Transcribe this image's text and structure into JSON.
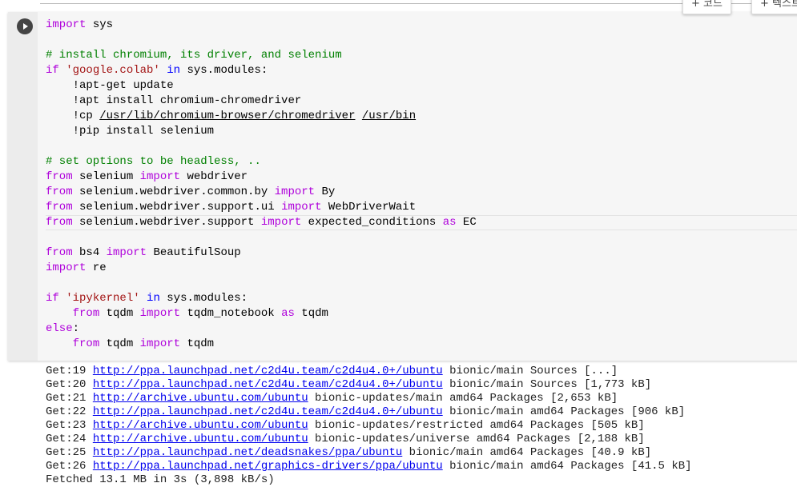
{
  "toolbar": {
    "add_code": "+ 코드",
    "add_text": "+ 텍스트"
  },
  "code_lines": [
    [
      [
        "kw",
        "import"
      ],
      [
        "t",
        " sys"
      ]
    ],
    [],
    [
      [
        "cm",
        "# install chromium, its driver, and selenium"
      ]
    ],
    [
      [
        "kw",
        "if"
      ],
      [
        "t",
        " "
      ],
      [
        "str",
        "'google.colab'"
      ],
      [
        "t",
        " "
      ],
      [
        "op",
        "in"
      ],
      [
        "t",
        " sys.modules:"
      ]
    ],
    [
      [
        "t",
        "    !apt-get update"
      ]
    ],
    [
      [
        "t",
        "    !apt install chromium-chromedriver"
      ]
    ],
    [
      [
        "t",
        "    !cp "
      ],
      [
        "ul",
        "/usr/lib/chromium-browser/chromedriver"
      ],
      [
        "t",
        " "
      ],
      [
        "ul",
        "/usr/bin"
      ]
    ],
    [
      [
        "t",
        "    !pip install selenium"
      ]
    ],
    [],
    [
      [
        "cm",
        "# set options to be headless, .."
      ]
    ],
    [
      [
        "kw",
        "from"
      ],
      [
        "t",
        " selenium "
      ],
      [
        "kw",
        "import"
      ],
      [
        "t",
        " webdriver"
      ]
    ],
    [
      [
        "kw",
        "from"
      ],
      [
        "t",
        " selenium.webdriver.common.by "
      ],
      [
        "kw",
        "import"
      ],
      [
        "t",
        " By"
      ]
    ],
    [
      [
        "kw",
        "from"
      ],
      [
        "t",
        " selenium.webdriver.support.ui "
      ],
      [
        "kw",
        "import"
      ],
      [
        "t",
        " WebDriverWait"
      ]
    ],
    [
      [
        "kw",
        "from"
      ],
      [
        "t",
        " selenium.webdriver.support "
      ],
      [
        "kw",
        "import"
      ],
      [
        "t",
        " expected_conditions "
      ],
      [
        "kw",
        "as"
      ],
      [
        "t",
        " EC"
      ]
    ],
    [],
    [
      [
        "kw",
        "from"
      ],
      [
        "t",
        " bs4 "
      ],
      [
        "kw",
        "import"
      ],
      [
        "t",
        " BeautifulSoup"
      ]
    ],
    [
      [
        "kw",
        "import"
      ],
      [
        "t",
        " re"
      ]
    ],
    [],
    [
      [
        "kw",
        "if"
      ],
      [
        "t",
        " "
      ],
      [
        "str",
        "'ipykernel'"
      ],
      [
        "t",
        " "
      ],
      [
        "op",
        "in"
      ],
      [
        "t",
        " sys.modules:"
      ]
    ],
    [
      [
        "t",
        "    "
      ],
      [
        "kw",
        "from"
      ],
      [
        "t",
        " tqdm "
      ],
      [
        "kw",
        "import"
      ],
      [
        "t",
        " tqdm_notebook "
      ],
      [
        "kw",
        "as"
      ],
      [
        "t",
        " tqdm"
      ]
    ],
    [
      [
        "kw",
        "else"
      ],
      [
        "t",
        ":"
      ]
    ],
    [
      [
        "t",
        "    "
      ],
      [
        "kw",
        "from"
      ],
      [
        "t",
        " tqdm "
      ],
      [
        "kw",
        "import"
      ],
      [
        "t",
        " tqdm"
      ]
    ]
  ],
  "output_lines": [
    {
      "prefix": "Get:19 ",
      "url": "http://ppa.launchpad.net/c2d4u.team/c2d4u4.0+/ubuntu",
      "suffix": " bionic/main Sources [...]"
    },
    {
      "prefix": "Get:20 ",
      "url": "http://ppa.launchpad.net/c2d4u.team/c2d4u4.0+/ubuntu",
      "suffix": " bionic/main Sources [1,773 kB]"
    },
    {
      "prefix": "Get:21 ",
      "url": "http://archive.ubuntu.com/ubuntu",
      "suffix": " bionic-updates/main amd64 Packages [2,653 kB]"
    },
    {
      "prefix": "Get:22 ",
      "url": "http://ppa.launchpad.net/c2d4u.team/c2d4u4.0+/ubuntu",
      "suffix": " bionic/main amd64 Packages [906 kB]"
    },
    {
      "prefix": "Get:23 ",
      "url": "http://archive.ubuntu.com/ubuntu",
      "suffix": " bionic-updates/restricted amd64 Packages [505 kB]"
    },
    {
      "prefix": "Get:24 ",
      "url": "http://archive.ubuntu.com/ubuntu",
      "suffix": " bionic-updates/universe amd64 Packages [2,188 kB]"
    },
    {
      "prefix": "Get:25 ",
      "url": "http://ppa.launchpad.net/deadsnakes/ppa/ubuntu",
      "suffix": " bionic/main amd64 Packages [40.9 kB]"
    },
    {
      "prefix": "Get:26 ",
      "url": "http://ppa.launchpad.net/graphics-drivers/ppa/ubuntu",
      "suffix": " bionic/main amd64 Packages [41.5 kB]"
    },
    {
      "prefix": "Fetched 13.1 MB in 3s (3,898 kB/s)",
      "url": "",
      "suffix": ""
    }
  ]
}
